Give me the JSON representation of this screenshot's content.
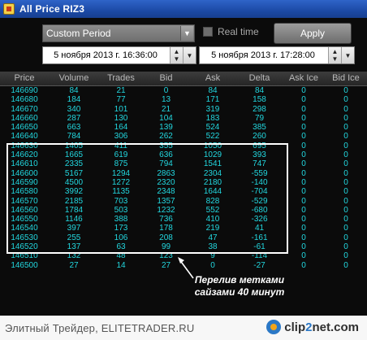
{
  "window": {
    "title": "All Price RIZ3"
  },
  "controls": {
    "period_value": "Custom Period",
    "realtime_label": "Real time",
    "apply_label": "Apply",
    "from_datetime": "5 ноября 2013 г. 16:36:00",
    "to_datetime": "5 ноября 2013 г. 17:28:00"
  },
  "table": {
    "columns": [
      "Price",
      "Volume",
      "Trades",
      "Bid",
      "Ask",
      "Delta",
      "Ask Ice",
      "Bid Ice"
    ],
    "rows": [
      [
        "146690",
        "84",
        "21",
        "0",
        "84",
        "84",
        "0",
        "0"
      ],
      [
        "146680",
        "184",
        "77",
        "13",
        "171",
        "158",
        "0",
        "0"
      ],
      [
        "146670",
        "340",
        "101",
        "21",
        "319",
        "298",
        "0",
        "0"
      ],
      [
        "146660",
        "287",
        "130",
        "104",
        "183",
        "79",
        "0",
        "0"
      ],
      [
        "146650",
        "663",
        "164",
        "139",
        "524",
        "385",
        "0",
        "0"
      ],
      [
        "146640",
        "784",
        "306",
        "262",
        "522",
        "260",
        "0",
        "0"
      ],
      [
        "146630",
        "1405",
        "411",
        "355",
        "1050",
        "695",
        "0",
        "0"
      ],
      [
        "146620",
        "1665",
        "619",
        "636",
        "1029",
        "393",
        "0",
        "0"
      ],
      [
        "146610",
        "2335",
        "875",
        "794",
        "1541",
        "747",
        "0",
        "0"
      ],
      [
        "146600",
        "5167",
        "1294",
        "2863",
        "2304",
        "-559",
        "0",
        "0"
      ],
      [
        "146590",
        "4500",
        "1272",
        "2320",
        "2180",
        "-140",
        "0",
        "0"
      ],
      [
        "146580",
        "3992",
        "1135",
        "2348",
        "1644",
        "-704",
        "0",
        "0"
      ],
      [
        "146570",
        "2185",
        "703",
        "1357",
        "828",
        "-529",
        "0",
        "0"
      ],
      [
        "146560",
        "1784",
        "503",
        "1232",
        "552",
        "-680",
        "0",
        "0"
      ],
      [
        "146550",
        "1146",
        "388",
        "736",
        "410",
        "-326",
        "0",
        "0"
      ],
      [
        "146540",
        "397",
        "173",
        "178",
        "219",
        "41",
        "0",
        "0"
      ],
      [
        "146530",
        "255",
        "106",
        "208",
        "47",
        "-161",
        "0",
        "0"
      ],
      [
        "146520",
        "137",
        "63",
        "99",
        "38",
        "-61",
        "0",
        "0"
      ],
      [
        "146510",
        "132",
        "48",
        "123",
        "9",
        "-114",
        "0",
        "0"
      ],
      [
        "146500",
        "27",
        "14",
        "27",
        "0",
        "-27",
        "0",
        "0"
      ]
    ]
  },
  "annotation": {
    "text": "Перелив метками сайзами 40 минут"
  },
  "footer": {
    "caption": "Элитный Трейдер, ELITETRADER.RU",
    "brand_clip": "clip",
    "brand_2": "2",
    "brand_net": "net.com"
  },
  "colors": {
    "value_text": "#22d7df",
    "header_text": "#b9b9b9",
    "background": "#0b0b0b"
  }
}
